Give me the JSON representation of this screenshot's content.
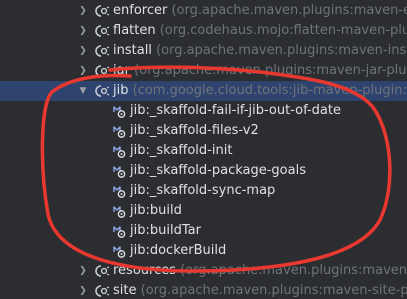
{
  "tree": {
    "plugins_before": [
      {
        "name": "enforcer",
        "meta": "(org.apache.maven.plugins:maven-ent"
      },
      {
        "name": "flatten",
        "meta": "(org.codehaus.mojo:flatten-maven-plu"
      },
      {
        "name": "install",
        "meta": "(org.apache.maven.plugins:maven-install"
      },
      {
        "name": "jar",
        "meta": "(org.apache.maven.plugins:maven-jar-plugin"
      }
    ],
    "expanded_plugin": {
      "name": "jib",
      "meta": "(com.google.cloud.tools:jib-maven-plugin:3."
    },
    "goals": [
      "jib:_skaffold-fail-if-jib-out-of-date",
      "jib:_skaffold-files-v2",
      "jib:_skaffold-init",
      "jib:_skaffold-package-goals",
      "jib:_skaffold-sync-map",
      "jib:build",
      "jib:buildTar",
      "jib:dockerBuild"
    ],
    "plugins_after": [
      {
        "name": "resources",
        "meta": "(org.apache.maven.plugins:maven-re"
      },
      {
        "name": "site",
        "meta": "(org.apache.maven.plugins:maven-site-plu"
      }
    ]
  },
  "icons": {
    "plugin": "maven-plugin-icon",
    "goal": "maven-goal-icon",
    "collapsed": "chevron-right-icon",
    "expanded": "chevron-down-icon"
  },
  "colors": {
    "background": "#2b2d30",
    "selection": "#2e436e",
    "text": "#dfe1e5",
    "secondary_text": "#6f737a",
    "annotation": "#e8382f"
  }
}
